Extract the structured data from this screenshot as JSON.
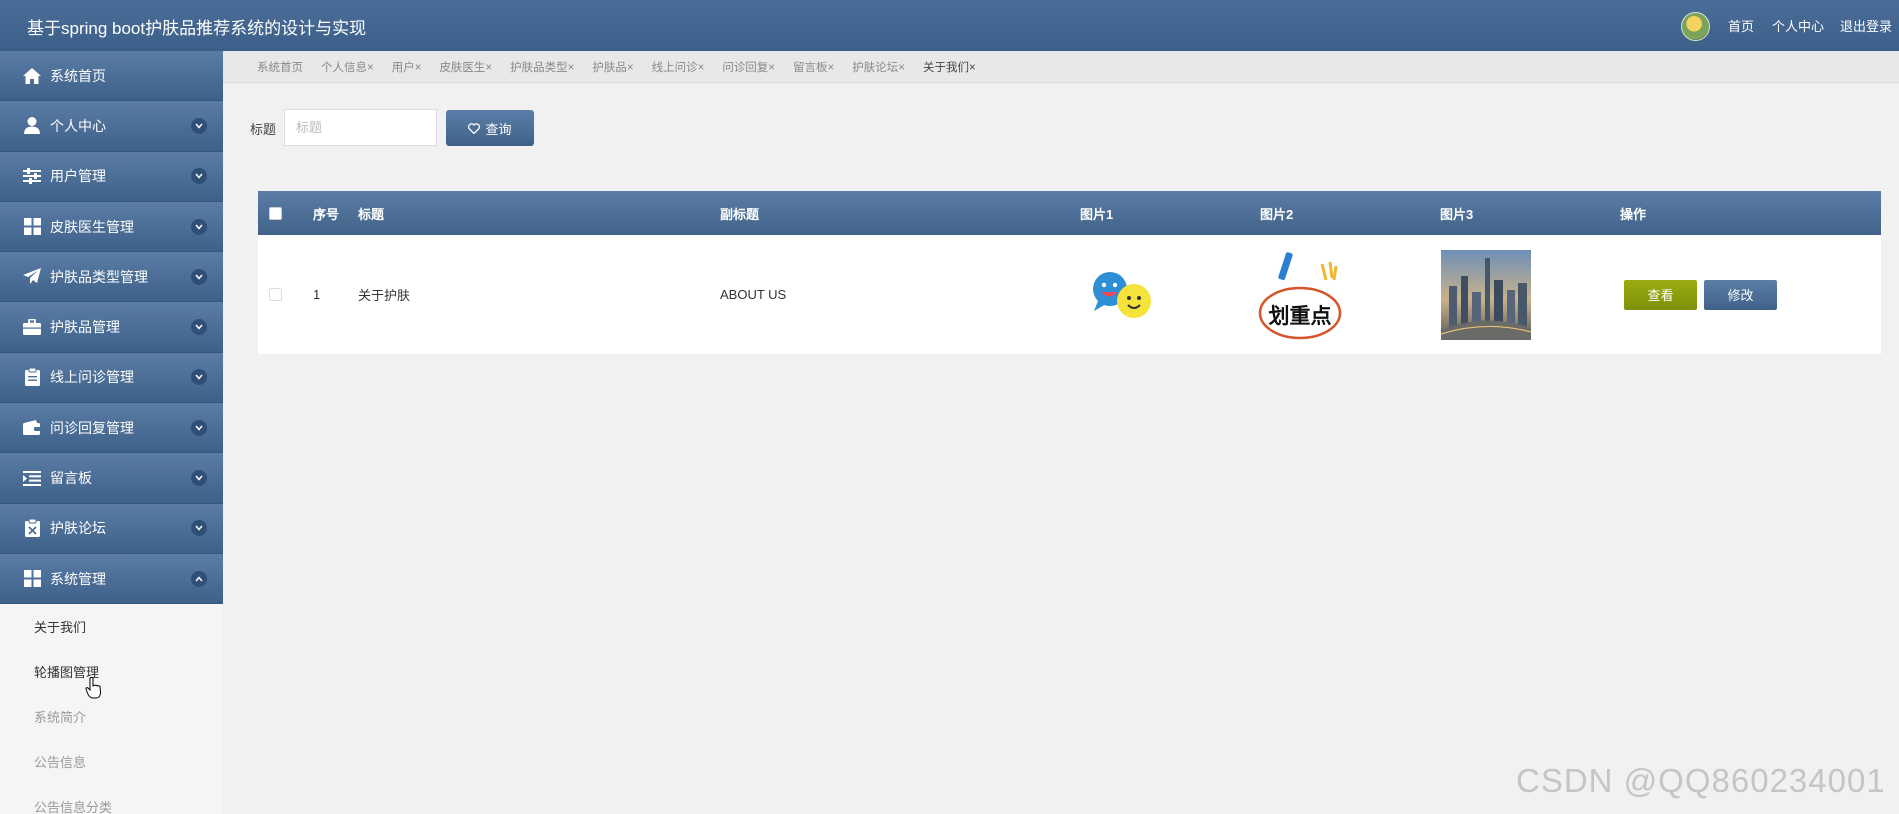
{
  "header": {
    "app_title": "基于spring boot护肤品推荐系统的设计与实现",
    "links": [
      "首页",
      "个人中心",
      "退出登录"
    ]
  },
  "sidebar": {
    "items": [
      {
        "label": "系统首页",
        "icon": "home-icon",
        "has_chevron": false
      },
      {
        "label": "个人中心",
        "icon": "user-icon",
        "has_chevron": true
      },
      {
        "label": "用户管理",
        "icon": "sliders-icon",
        "has_chevron": true
      },
      {
        "label": "皮肤医生管理",
        "icon": "grid-icon",
        "has_chevron": true
      },
      {
        "label": "护肤品类型管理",
        "icon": "paper-plane-icon",
        "has_chevron": true
      },
      {
        "label": "护肤品管理",
        "icon": "briefcase-icon",
        "has_chevron": true
      },
      {
        "label": "线上问诊管理",
        "icon": "clipboard-icon",
        "has_chevron": true
      },
      {
        "label": "问诊回复管理",
        "icon": "wallet-icon",
        "has_chevron": true
      },
      {
        "label": "留言板",
        "icon": "list-indent-icon",
        "has_chevron": true
      },
      {
        "label": "护肤论坛",
        "icon": "clipboard-x-icon",
        "has_chevron": true
      },
      {
        "label": "系统管理",
        "icon": "grid-icon",
        "has_chevron": true,
        "expanded": true
      }
    ],
    "sub_items": [
      {
        "label": "关于我们",
        "dim": false
      },
      {
        "label": "轮播图管理",
        "dim": false
      },
      {
        "label": "系统简介",
        "dim": true
      },
      {
        "label": "公告信息",
        "dim": true
      },
      {
        "label": "公告信息分类",
        "dim": true
      }
    ]
  },
  "tabs": [
    {
      "label": "系统首页",
      "active": false
    },
    {
      "label": "个人信息×",
      "active": false
    },
    {
      "label": "用户×",
      "active": false
    },
    {
      "label": "皮肤医生×",
      "active": false
    },
    {
      "label": "护肤品类型×",
      "active": false
    },
    {
      "label": "护肤品×",
      "active": false
    },
    {
      "label": "线上问诊×",
      "active": false
    },
    {
      "label": "问诊回复×",
      "active": false
    },
    {
      "label": "留言板×",
      "active": false
    },
    {
      "label": "护肤论坛×",
      "active": false
    },
    {
      "label": "关于我们×",
      "active": true
    }
  ],
  "search": {
    "label": "标题",
    "placeholder": "标题",
    "value": "",
    "button_label": "查询"
  },
  "table": {
    "headers": [
      "序号",
      "标题",
      "副标题",
      "图片1",
      "图片2",
      "图片3",
      "操作"
    ],
    "rows": [
      {
        "index": "1",
        "title": "关于护肤",
        "subtitle": "ABOUT US",
        "image2_text": "划重点",
        "actions": [
          "查看",
          "修改"
        ]
      }
    ]
  },
  "watermark": "CSDN @QQ860234001"
}
